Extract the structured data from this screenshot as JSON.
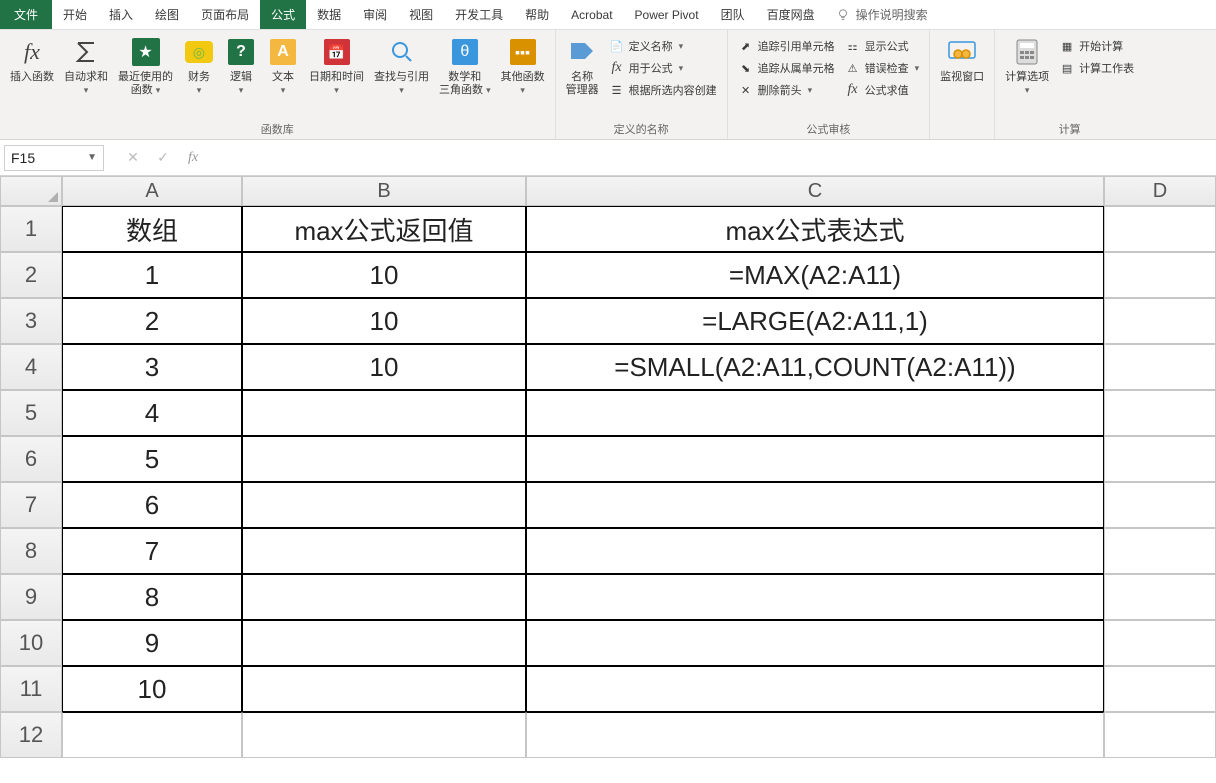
{
  "menus": {
    "file": "文件",
    "home": "开始",
    "insert": "插入",
    "draw": "绘图",
    "layout": "页面布局",
    "formulas": "公式",
    "data": "数据",
    "review": "审阅",
    "view": "视图",
    "dev": "开发工具",
    "help": "帮助",
    "acrobat": "Acrobat",
    "powerpivot": "Power Pivot",
    "team": "团队",
    "baidu": "百度网盘",
    "search": "操作说明搜索"
  },
  "ribbon": {
    "insert_func": "插入函数",
    "autosum": "自动求和",
    "recent": "最近使用的\n函数",
    "financial": "财务",
    "logical": "逻辑",
    "text": "文本",
    "datetime": "日期和时间",
    "lookup": "查找与引用",
    "math": "数学和\n三角函数",
    "other": "其他函数",
    "group_lib": "函数库",
    "name_mgr": "名称\n管理器",
    "def_name": "定义名称",
    "use_formula": "用于公式",
    "from_sel": "根据所选内容创建",
    "group_names": "定义的名称",
    "trace_prec": "追踪引用单元格",
    "trace_dep": "追踪从属单元格",
    "remove_arrows": "删除箭头",
    "show_formulas": "显示公式",
    "error_check": "错误检查",
    "eval_formula": "公式求值",
    "group_audit": "公式审核",
    "watch": "监视窗口",
    "calc_options": "计算选项",
    "calc_now": "开始计算",
    "calc_sheet": "计算工作表",
    "group_calc": "计算"
  },
  "formula_bar": {
    "name_box": "F15",
    "input": ""
  },
  "cols": {
    "A": "A",
    "B": "B",
    "C": "C",
    "D": "D"
  },
  "rows": [
    "1",
    "2",
    "3",
    "4",
    "5",
    "6",
    "7",
    "8",
    "9",
    "10",
    "11",
    "12"
  ],
  "table": {
    "hA": "数组",
    "hB": "max公式返回值",
    "hC": "max公式表达式",
    "A": [
      "1",
      "2",
      "3",
      "4",
      "5",
      "6",
      "7",
      "8",
      "9",
      "10"
    ],
    "B": [
      "10",
      "10",
      "10",
      "",
      "",
      "",
      "",
      "",
      "",
      ""
    ],
    "C": [
      "=MAX(A2:A11)",
      "=LARGE(A2:A11,1)",
      "=SMALL(A2:A11,COUNT(A2:A11))",
      "",
      "",
      "",
      "",
      "",
      "",
      ""
    ]
  }
}
